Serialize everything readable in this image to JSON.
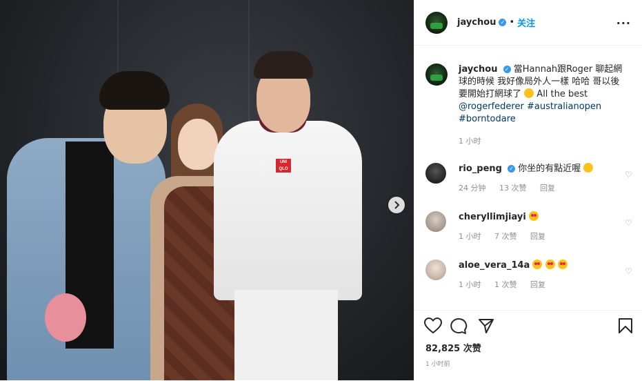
{
  "header": {
    "username": "jaychou",
    "follow_label": "关注",
    "more_label": "···"
  },
  "caption": {
    "username": "jaychou",
    "text": "當Hannah跟Roger 聊起網球的時候 我好像局外人一樣 哈哈 哥以後要開始打網球了",
    "text_tail": "All the best",
    "mention": "@rogerfederer",
    "hashtag1": "#australianopen",
    "hashtag2": "#borntodare",
    "time": "1 小时"
  },
  "comments": [
    {
      "username": "rio_peng",
      "text": "你坐的有點近喔",
      "time": "24 分钟",
      "likes": "13 次赞",
      "reply": "回复"
    },
    {
      "username": "cheryllimjiayi",
      "text": "",
      "time": "1 小时",
      "likes": "7 次赞",
      "reply": "回复"
    },
    {
      "username": "aloe_vera_14a",
      "text": "",
      "time": "1 小时",
      "likes": "1 次赞",
      "reply": "回复"
    }
  ],
  "footer": {
    "likes": "82,825 次赞",
    "time": "1 小时前"
  },
  "photo": {
    "shirt_logo": "UNI\nQLO",
    "bg_color": "#24272b"
  },
  "icons": [
    "heart-icon",
    "comment-icon",
    "share-icon",
    "bookmark-icon",
    "chevron-right-icon",
    "verified-icon",
    "more-icon"
  ],
  "colors": {
    "accent": "#0095f6",
    "verified": "#3897f0",
    "link": "#00376b"
  }
}
